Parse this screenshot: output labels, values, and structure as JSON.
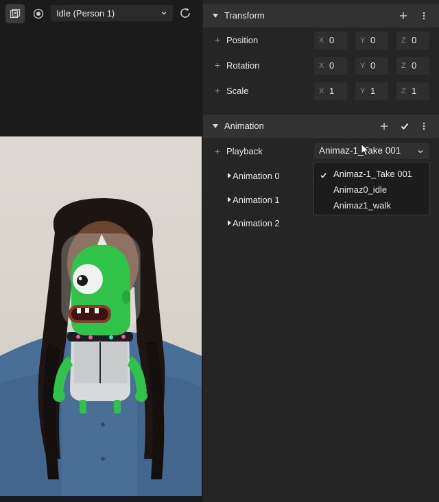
{
  "viewport": {
    "person_select": "Idle (Person 1)"
  },
  "transform": {
    "title": "Transform",
    "rows": [
      {
        "label": "Position",
        "x": "0",
        "y": "0",
        "z": "0"
      },
      {
        "label": "Rotation",
        "x": "0",
        "y": "0",
        "z": "0"
      },
      {
        "label": "Scale",
        "x": "1",
        "y": "1",
        "z": "1"
      }
    ],
    "axis": {
      "x": "X",
      "y": "Y",
      "z": "Z"
    }
  },
  "animation": {
    "title": "Animation",
    "playback_label": "Playback",
    "playback_value": "Animaz-1_Take 001",
    "items": [
      "Animation 0",
      "Animation 1",
      "Animation 2"
    ],
    "options": [
      "Animaz-1_Take 001",
      "Animaz0_idle",
      "Animaz1_walk"
    ]
  },
  "icons": {
    "simulator": "simulator-icon",
    "target": "target-icon",
    "refresh": "refresh-icon",
    "add": "plus-icon",
    "more": "more-vertical-icon",
    "check": "checkmark-icon"
  },
  "colors": {
    "panel_bg": "#252525",
    "header_bg": "#323232",
    "field_bg": "#2e2e2e",
    "character_green": "#2fc34a"
  }
}
